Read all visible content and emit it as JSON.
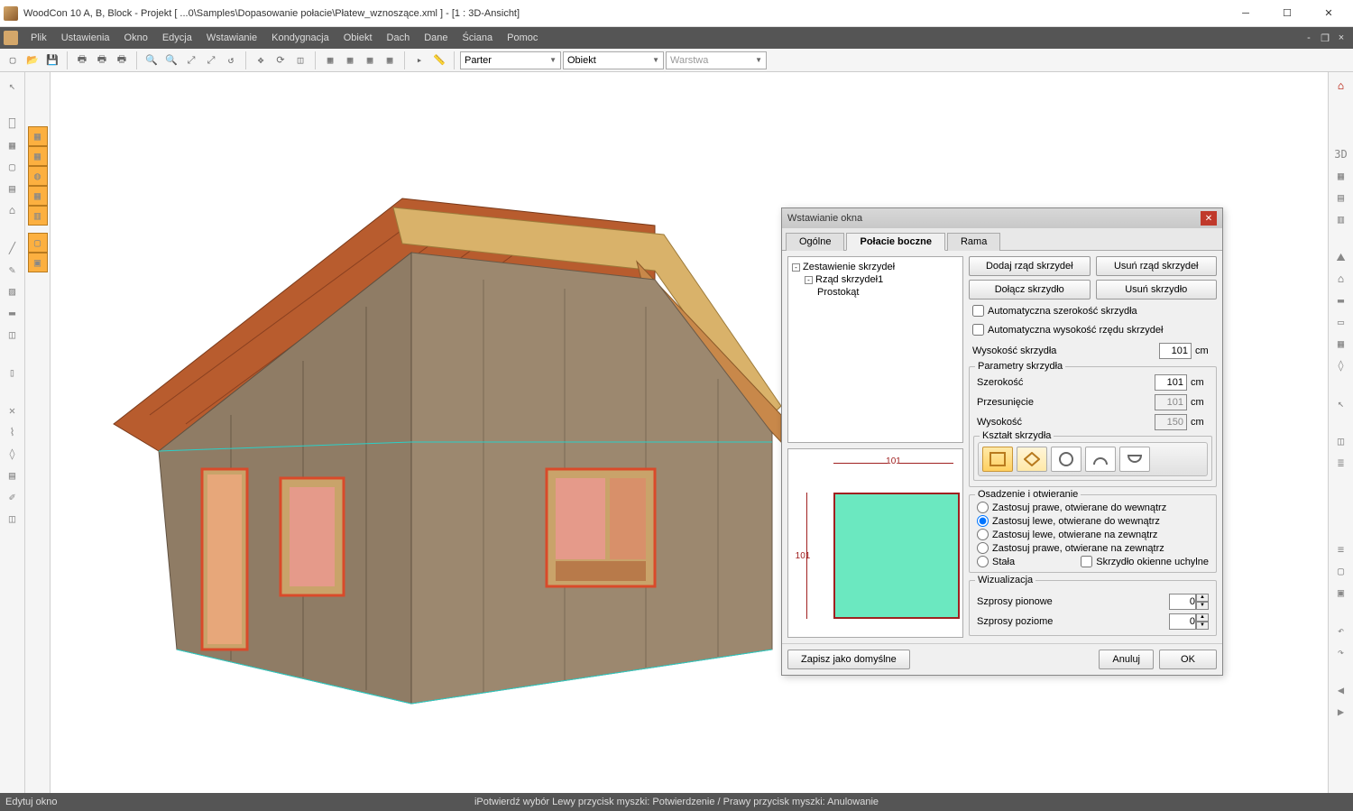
{
  "window": {
    "title": "WoodCon 10 A, B, Block - Projekt [ ...0\\Samples\\Dopasowanie połacie\\Płatew_wznoszące.xml ]  - [1 : 3D-Ansicht]"
  },
  "menu": {
    "items": [
      "Plik",
      "Ustawienia",
      "Okno",
      "Edycja",
      "Wstawianie",
      "Kondygnacja",
      "Obiekt",
      "Dach",
      "Dane",
      "Ściana",
      "Pomoc"
    ]
  },
  "toolbar": {
    "combo_floor": "Parter",
    "combo_object": "Obiekt",
    "combo_layer": "Warstwa"
  },
  "dialog": {
    "title": "Wstawianie okna",
    "tabs": {
      "general": "Ogólne",
      "side": "Połacie boczne",
      "frame": "Rama"
    },
    "tree": {
      "root": "Zestawienie skrzydeł",
      "row": "Rząd skrzydeł1",
      "leaf": "Prostokąt"
    },
    "buttons": {
      "add_row": "Dodaj rząd skrzydeł",
      "del_row": "Usuń rząd skrzydeł",
      "add_sash": "Dołącz skrzydło",
      "del_sash": "Usuń skrzydło",
      "save_default": "Zapisz jako domyślne",
      "cancel": "Anuluj",
      "ok": "OK"
    },
    "checks": {
      "auto_width": "Automatyczna szerokość skrzydła",
      "auto_height": "Automatyczna wysokość rzędu skrzydeł",
      "tilt": "Skrzydło okienne uchylne"
    },
    "fields": {
      "sash_height_label": "Wysokość skrzydła",
      "sash_height": "101",
      "params_legend": "Parametry skrzydła",
      "width_label": "Szerokość",
      "width": "101",
      "offset_label": "Przesunięcie",
      "offset": "101",
      "height_label": "Wysokość",
      "height": "150",
      "shape_legend": "Kształt skrzydła",
      "hinge_legend": "Osadzenie i otwieranie",
      "viz_legend": "Wizualizacja",
      "spros_v_label": "Szprosy pionowe",
      "spros_v": "0",
      "spros_h_label": "Szprosy poziome",
      "spros_h": "0",
      "unit": "cm"
    },
    "radios": {
      "r1": "Zastosuj prawe, otwierane do wewnątrz",
      "r2": "Zastosuj lewe, otwierane do wewnątrz",
      "r3": "Zastosuj lewe, otwierane na zewnątrz",
      "r4": "Zastosuj prawe, otwierane na zewnątrz",
      "r5": "Stała"
    },
    "preview": {
      "w": "101",
      "h": "101"
    }
  },
  "status": {
    "left": "Edytuj okno",
    "center": "iPotwierdź wybór Lewy przycisk myszki: Potwierdzenie / Prawy przycisk myszki: Anulowanie"
  }
}
